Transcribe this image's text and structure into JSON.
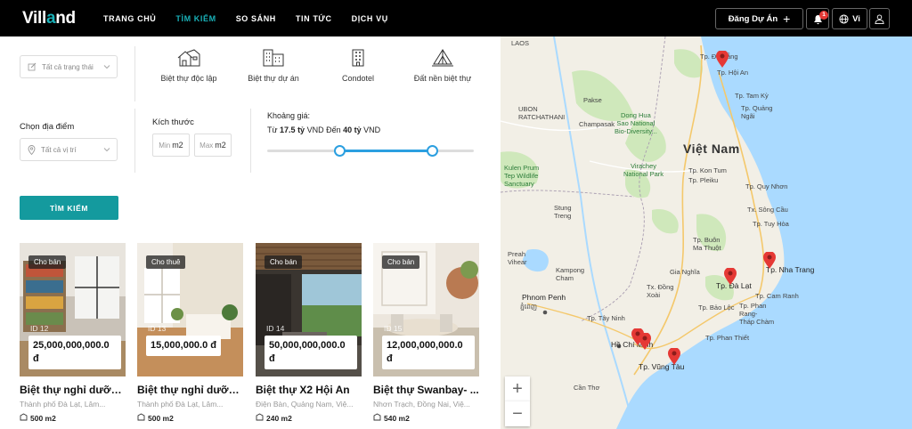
{
  "header": {
    "logo_part1": "Vill",
    "logo_part2": "a",
    "logo_part3": "nd",
    "nav": [
      "TRANG CHỦ",
      "TÌM KIẾM",
      "SO SÁNH",
      "TIN TỨC",
      "DỊCH VỤ"
    ],
    "active_nav": 1,
    "post_button": "Đăng Dự Án",
    "notification_count": "1",
    "language": "Vi"
  },
  "filters": {
    "status_placeholder": "Tất cả trạng thái",
    "property_types": [
      "Biệt thự độc lập",
      "Biệt thự dự án",
      "Condotel",
      "Đất nền biệt thự"
    ],
    "location_label": "Chọn địa điểm",
    "location_placeholder": "Tất cả vị trí",
    "size_label": "Kích thước",
    "size_min_placeholder": "Min",
    "size_max_placeholder": "Max",
    "size_unit": "m2",
    "price_label": "Khoảng giá:",
    "price_from_word": "Từ",
    "price_min": "17.5 tỷ",
    "price_mid_text": "VND Đến",
    "price_max": "40 tỷ",
    "price_end_text": "VND",
    "slider_min_fraction": 0.35,
    "slider_max_fraction": 0.8,
    "search_button": "TÌM KIẾM"
  },
  "listings": [
    {
      "tag": "Cho bán",
      "id": "ID 12",
      "price": "25,000,000,000.0 đ",
      "title": "Biệt thự nghỉ dưỡng...",
      "location": "Thành phố Đà Lạt, Lâm...",
      "area": "500 m2"
    },
    {
      "tag": "Cho thuê",
      "id": "ID 13",
      "price": "15,000,000.0 đ",
      "title": "Biệt thự nghỉ dưỡng...",
      "location": "Thành phố Đà Lạt, Lâm...",
      "area": "500 m2"
    },
    {
      "tag": "Cho bán",
      "id": "ID 14",
      "price": "50,000,000,000.0 đ",
      "title": "Biệt thự X2 Hội An",
      "location": "Điện Bàn, Quảng Nam, Việ...",
      "area": "240 m2"
    },
    {
      "tag": "Cho bán",
      "id": "ID 15",
      "price": "12,000,000,000.0 đ",
      "title": "Biệt thự Swanbay- ...",
      "location": "Nhơn Trạch, Đồng Nai, Việ...",
      "area": "540 m2"
    }
  ],
  "map": {
    "country_label": "Việt Nam",
    "labels": {
      "laos": "LAOS",
      "cambodia_city": "Phnom Penh",
      "cambodia_khmer": "ភ្នំពេញ",
      "ratchathani": "UBON\nRATCHATHANI",
      "pakse": "Pakse",
      "champasak": "Champasak",
      "dong_hua_sao": "Dong Hua\nSao National\nBio-Diversity...",
      "virachey": "Virachey\nNational Park",
      "kulen": "Kulen Prum\nTep Wildlife\nSanctuary",
      "preah": "Preah\nVihear",
      "stung": "Stung\nTreng",
      "kampong_cham": "Kampong\nCham",
      "da_nang": "Tp. Đà Nẵng",
      "hoi_an": "Tp. Hội An",
      "tam_ky": "Tp. Tam Kỳ",
      "quang_ngai": "Tp. Quảng\nNgãi",
      "kon_tum": "Tp. Kon Tum",
      "pleiku": "Tp. Pleiku",
      "quy_nhon": "Tp. Quy Nhơn",
      "song_cau": "Tx. Sông Cầu",
      "tuy_hoa": "Tp. Tuy Hòa",
      "buon_ma_thuot": "Tp. Buôn\nMa Thuột",
      "nha_trang": "Tp. Nha Trang",
      "da_lat": "Tp. Đà Lạt",
      "cam_ranh": "Tp. Cam Ranh",
      "bao_loc": "Tp. Bảo Lộc",
      "phan_rang": "Tp. Phan\nRang-\nTháp Chàm",
      "tay_ninh": "Tp. Tây Ninh",
      "ho_chi_minh": "Hồ Chí Minh",
      "vung_tau": "Tp. Vũng Tàu",
      "phan_thiet": "Tp. Phan Thiết",
      "can_tho": "Cần Thơ",
      "dong_xoai": "Tx. Đồng\nXoài",
      "gia_nghia": "Gia Nghĩa"
    },
    "zoom_in": "+",
    "zoom_out": "−",
    "marker_color": "#e53935"
  }
}
